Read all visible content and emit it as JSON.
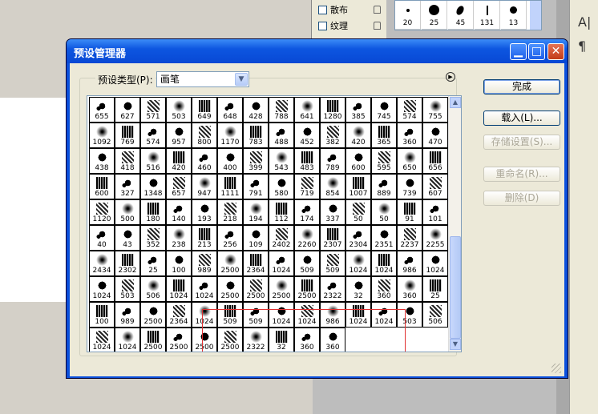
{
  "panel": {
    "items": [
      {
        "label": "散布"
      },
      {
        "label": "纹理"
      }
    ]
  },
  "thumbs": [
    "20",
    "25",
    "45",
    "131",
    "13"
  ],
  "dialog": {
    "title": "预设管理器",
    "preset_type_label": "预设类型(P):",
    "preset_type_value": "画笔",
    "buttons": {
      "done": "完成",
      "load": "载入(L)...",
      "save": "存储设置(S)...",
      "rename": "重命名(R)...",
      "delete": "删除(D)"
    }
  },
  "brushes": [
    [
      "655",
      "627",
      "571",
      "503",
      "649",
      "648",
      "428",
      "788",
      "641",
      "1280",
      "385",
      "745",
      "574",
      "755"
    ],
    [
      "1092",
      "769",
      "574",
      "957",
      "800",
      "1170",
      "783",
      "488",
      "452",
      "382",
      "420",
      "365",
      "360",
      "470"
    ],
    [
      "438",
      "418",
      "516",
      "420",
      "460",
      "400",
      "399",
      "543",
      "483",
      "789",
      "600",
      "595",
      "650",
      "656"
    ],
    [
      "600",
      "327",
      "1348",
      "657",
      "947",
      "1111",
      "791",
      "580",
      "719",
      "854",
      "1007",
      "889",
      "739",
      "607"
    ],
    [
      "1120",
      "500",
      "180",
      "140",
      "193",
      "218",
      "194",
      "112",
      "174",
      "337",
      "50",
      "50",
      "91",
      "101"
    ],
    [
      "40",
      "43",
      "352",
      "238",
      "213",
      "256",
      "109",
      "2402",
      "2260",
      "2307",
      "2304",
      "2351",
      "2237",
      "2255"
    ],
    [
      "2434",
      "2302",
      "25",
      "100",
      "989",
      "2500",
      "2364",
      "1024",
      "509",
      "509",
      "1024",
      "1024",
      "986",
      "1024"
    ],
    [
      "1024",
      "503",
      "506",
      "1024",
      "1024",
      "2500",
      "2500",
      "2500",
      "2500",
      "2322",
      "32",
      "360",
      "360",
      "25"
    ],
    [
      "100",
      "989",
      "2500",
      "2364",
      "1024",
      "509",
      "509",
      "1024",
      "1024",
      "986",
      "1024",
      "1024",
      "503",
      "506"
    ],
    [
      "1024",
      "1024",
      "2500",
      "2500",
      "2500",
      "2500",
      "2322",
      "32",
      "360",
      "360"
    ]
  ],
  "colors": {
    "title": "#0d56e0",
    "accent": "#003c74",
    "selection": "#e03030"
  }
}
